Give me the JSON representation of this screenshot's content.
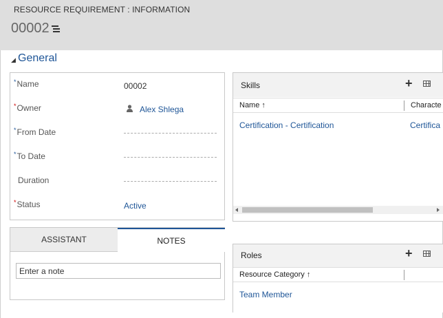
{
  "header": {
    "entity_title": "RESOURCE REQUIREMENT : INFORMATION",
    "record_name": "00002"
  },
  "section": {
    "title": "General"
  },
  "fields": [
    {
      "label": "Name",
      "value": "00002",
      "required": "recommended"
    },
    {
      "label": "Owner",
      "value": "Alex Shlega",
      "required": "required"
    },
    {
      "label": "From Date",
      "value": "",
      "required": "recommended"
    },
    {
      "label": "To Date",
      "value": "",
      "required": "recommended"
    },
    {
      "label": "Duration",
      "value": "",
      "required": "none"
    },
    {
      "label": "Status",
      "value": "Active",
      "required": "required"
    }
  ],
  "required_marker": "*",
  "tabs": {
    "assistant": "ASSISTANT",
    "notes": "NOTES"
  },
  "notes": {
    "placeholder": "Enter a note"
  },
  "skills": {
    "title": "Skills",
    "add_icon": "+",
    "columns": [
      "Name ↑",
      "Characte"
    ],
    "rows": [
      [
        "Certification - Certification",
        "Certifica"
      ]
    ]
  },
  "roles": {
    "title": "Roles",
    "add_icon": "+",
    "columns": [
      "Resource Category ↑"
    ],
    "rows": [
      [
        "Team Member"
      ]
    ]
  },
  "colors": {
    "accent": "#1e5597",
    "required_red": "#cc0000",
    "header_bg": "#dedede"
  }
}
